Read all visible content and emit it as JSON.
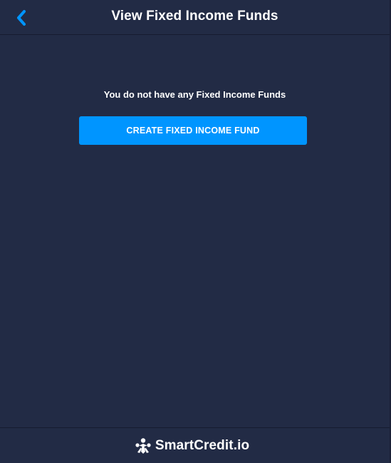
{
  "header": {
    "back_icon": "chevron-left-icon",
    "title": "View Fixed Income Funds"
  },
  "main": {
    "empty_message": "You do not have any Fixed Income Funds",
    "create_button_label": "CREATE FIXED INCOME FUND"
  },
  "footer": {
    "brand_icon": "smartcredit-logo-icon",
    "brand_name": "SmartCredit.io"
  },
  "colors": {
    "background": "#222b45",
    "accent": "#0095ff",
    "text": "#ffffff"
  }
}
